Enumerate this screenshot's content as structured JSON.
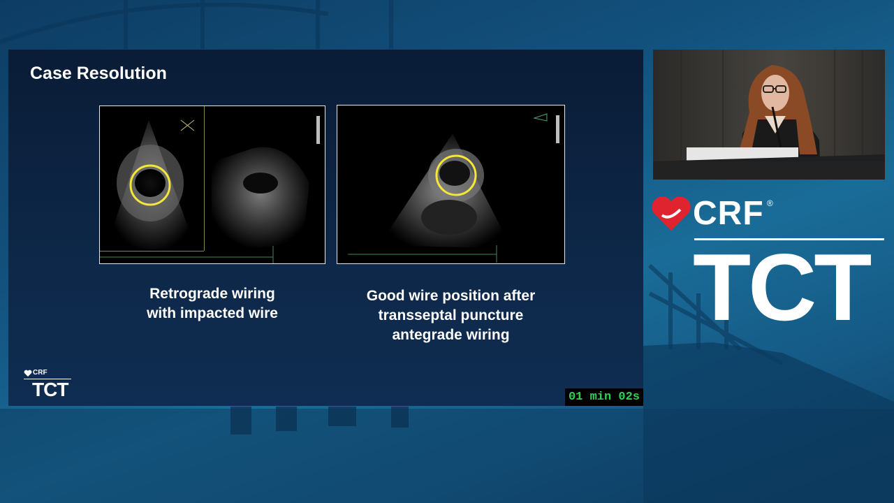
{
  "slide": {
    "title": "Case Resolution",
    "captions": [
      {
        "lines": [
          "Retrograde wiring",
          "with impacted wire"
        ]
      },
      {
        "lines": [
          "Good wire position after",
          "transseptal puncture",
          "antegrade wiring"
        ]
      }
    ],
    "footer_logo": {
      "crf": "CRF",
      "tct": "TCT"
    }
  },
  "timer": {
    "text": "01 min 02s",
    "color": "#2fd05a"
  },
  "brand": {
    "crf": "CRF",
    "registered": "®",
    "tct": "TCT",
    "heart_color": "#e0242f"
  },
  "colors": {
    "highlight_circle": "#f5e63a",
    "slide_bg": "#0b1f3b"
  },
  "icons": [
    "crf-heart-icon",
    "bridge-background"
  ]
}
